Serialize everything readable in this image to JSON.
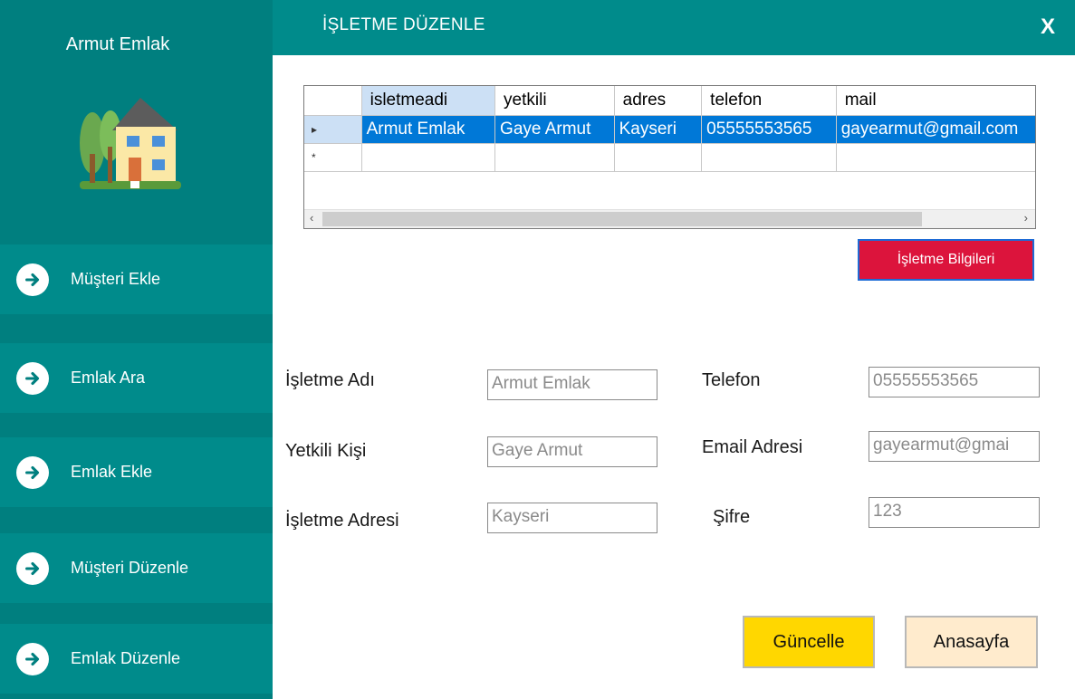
{
  "sidebar": {
    "brand": "Armut Emlak",
    "items": [
      {
        "label": "Müşteri Ekle"
      },
      {
        "label": "Emlak Ara"
      },
      {
        "label": "Emlak Ekle"
      },
      {
        "label": "Müşteri Düzenle"
      },
      {
        "label": "Emlak Düzenle"
      }
    ]
  },
  "header": {
    "title": "İŞLETME DÜZENLE",
    "close_label": "X"
  },
  "grid": {
    "columns": [
      "isletmeadi",
      "yetkili",
      "adres",
      "telefon",
      "mail"
    ],
    "rows": [
      [
        "Armut Emlak",
        "Gaye Armut",
        "Kayseri",
        "05555553565",
        "gayearmut@gmail.com"
      ]
    ],
    "selected_row_marker": "▸",
    "new_row_marker": "*",
    "scroll_left": "‹",
    "scroll_right": "›"
  },
  "info_button_label": "İşletme Bilgileri",
  "form": {
    "business_name": {
      "label": "İşletme Adı",
      "value": "Armut Emlak"
    },
    "contact_person": {
      "label": "Yetkili Kişi",
      "value": "Gaye Armut"
    },
    "business_address": {
      "label": "İşletme Adresi",
      "value": "Kayseri"
    },
    "phone": {
      "label": "Telefon",
      "value": "05555553565"
    },
    "email": {
      "label": "Email Adresi",
      "value": "gayearmut@gmai"
    },
    "password": {
      "label": "Şifre",
      "value": "123"
    }
  },
  "buttons": {
    "update": "Güncelle",
    "home": "Anasayfa"
  },
  "colors": {
    "sidebar_bg": "#007f7f",
    "teal": "#008b8b",
    "red_button": "#dc143c",
    "update_button": "#ffd700",
    "home_button": "#ffebcd",
    "row_selected": "#0078d7"
  }
}
